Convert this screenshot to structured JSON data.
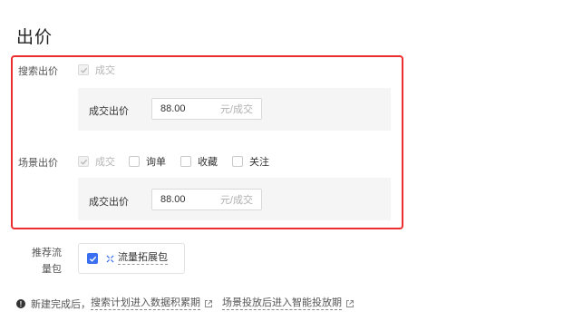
{
  "page_title": "出价",
  "search_bid": {
    "label": "搜索出价",
    "checkbox_label": "成交",
    "panel_label": "成交出价",
    "input_value": "88.00",
    "input_unit": "元/成交"
  },
  "scene_bid": {
    "label": "场景出价",
    "options": [
      "成交",
      "询单",
      "收藏",
      "关注"
    ],
    "panel_label": "成交出价",
    "input_value": "88.00",
    "input_unit": "元/成交"
  },
  "recommend_package": {
    "label": "推荐流量包",
    "option_label": "流量拓展包",
    "checked": true
  },
  "footer": {
    "prefix": "新建完成后，",
    "link1": "搜索计划进入数据积累期",
    "link2": "场景投放后进入智能投放期"
  },
  "colors": {
    "highlight_border": "#ee2e2e",
    "checkbox_blue": "#3a6ff2",
    "panel_bg": "#f5f5f5"
  }
}
